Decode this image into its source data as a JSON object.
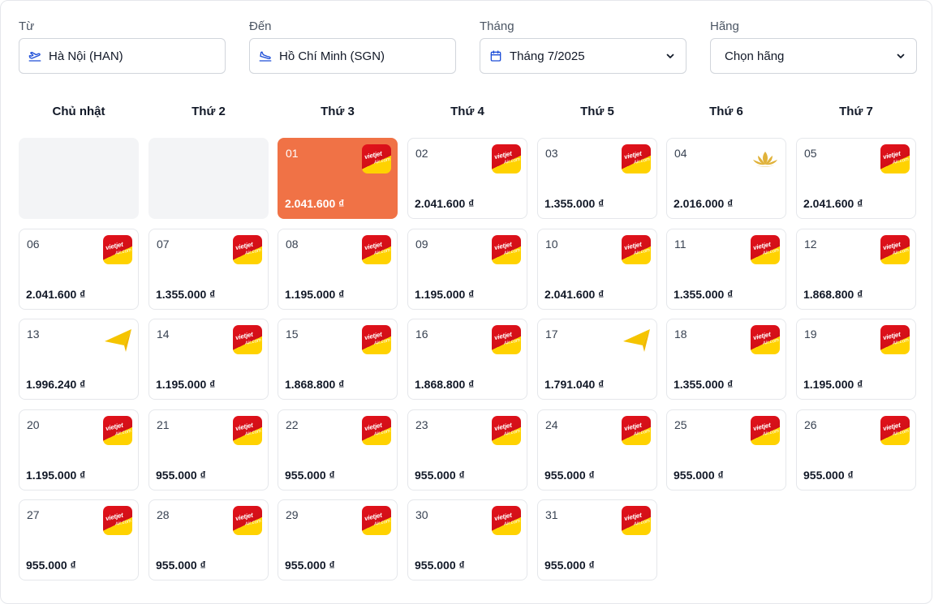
{
  "filters": {
    "from": {
      "label": "Từ",
      "value": "Hà Nội (HAN)",
      "icon": "plane-takeoff-icon"
    },
    "to": {
      "label": "Đến",
      "value": "Hồ Chí Minh (SGN)",
      "icon": "plane-landing-icon"
    },
    "month": {
      "label": "Tháng",
      "value": "Tháng 7/2025",
      "icon": "calendar-icon"
    },
    "airline": {
      "label": "Hãng",
      "value": "Chọn hãng"
    }
  },
  "weekdays": [
    "Chủ nhật",
    "Thứ 2",
    "Thứ 3",
    "Thứ 4",
    "Thứ 5",
    "Thứ 6",
    "Thứ 7"
  ],
  "airlines": {
    "vj": {
      "name": "Vietjet Air",
      "logo_text_1": "vietjet",
      "logo_text_2": "Air.com",
      "colors": [
        "#e3121b",
        "#ffd200"
      ]
    },
    "vna": {
      "name": "Vietnam Airlines",
      "icon": "lotus-icon",
      "color": "#e0b23a"
    },
    "bamboo": {
      "name": "Vietravel / paper-plane airline",
      "icon": "paper-plane-icon",
      "color": "#f5c400"
    }
  },
  "selected_color": "#f07246",
  "leading_empty_days": 2,
  "days": [
    {
      "day": "01",
      "price": "2.041.600 ₫",
      "airline": "vj",
      "selected": true
    },
    {
      "day": "02",
      "price": "2.041.600 ₫",
      "airline": "vj"
    },
    {
      "day": "03",
      "price": "1.355.000 ₫",
      "airline": "vj"
    },
    {
      "day": "04",
      "price": "2.016.000 ₫",
      "airline": "vna"
    },
    {
      "day": "05",
      "price": "2.041.600 ₫",
      "airline": "vj"
    },
    {
      "day": "06",
      "price": "2.041.600 ₫",
      "airline": "vj"
    },
    {
      "day": "07",
      "price": "1.355.000 ₫",
      "airline": "vj"
    },
    {
      "day": "08",
      "price": "1.195.000 ₫",
      "airline": "vj"
    },
    {
      "day": "09",
      "price": "1.195.000 ₫",
      "airline": "vj"
    },
    {
      "day": "10",
      "price": "2.041.600 ₫",
      "airline": "vj"
    },
    {
      "day": "11",
      "price": "1.355.000 ₫",
      "airline": "vj"
    },
    {
      "day": "12",
      "price": "1.868.800 ₫",
      "airline": "vj"
    },
    {
      "day": "13",
      "price": "1.996.240 ₫",
      "airline": "bamboo"
    },
    {
      "day": "14",
      "price": "1.195.000 ₫",
      "airline": "vj"
    },
    {
      "day": "15",
      "price": "1.868.800 ₫",
      "airline": "vj"
    },
    {
      "day": "16",
      "price": "1.868.800 ₫",
      "airline": "vj"
    },
    {
      "day": "17",
      "price": "1.791.040 ₫",
      "airline": "bamboo"
    },
    {
      "day": "18",
      "price": "1.355.000 ₫",
      "airline": "vj"
    },
    {
      "day": "19",
      "price": "1.195.000 ₫",
      "airline": "vj"
    },
    {
      "day": "20",
      "price": "1.195.000 ₫",
      "airline": "vj"
    },
    {
      "day": "21",
      "price": "955.000 ₫",
      "airline": "vj"
    },
    {
      "day": "22",
      "price": "955.000 ₫",
      "airline": "vj"
    },
    {
      "day": "23",
      "price": "955.000 ₫",
      "airline": "vj"
    },
    {
      "day": "24",
      "price": "955.000 ₫",
      "airline": "vj"
    },
    {
      "day": "25",
      "price": "955.000 ₫",
      "airline": "vj"
    },
    {
      "day": "26",
      "price": "955.000 ₫",
      "airline": "vj"
    },
    {
      "day": "27",
      "price": "955.000 ₫",
      "airline": "vj"
    },
    {
      "day": "28",
      "price": "955.000 ₫",
      "airline": "vj"
    },
    {
      "day": "29",
      "price": "955.000 ₫",
      "airline": "vj"
    },
    {
      "day": "30",
      "price": "955.000 ₫",
      "airline": "vj"
    },
    {
      "day": "31",
      "price": "955.000 ₫",
      "airline": "vj"
    }
  ]
}
